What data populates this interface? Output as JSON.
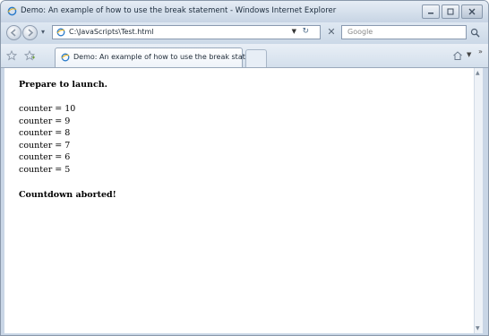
{
  "window": {
    "title": "Demo: An example of how to use the break statement - Windows Internet Explorer"
  },
  "nav": {
    "address": "C:\\JavaScripts\\Test.html",
    "search_placeholder": "Google"
  },
  "tabs": [
    {
      "label": "Demo: An example of how to use the break state..."
    }
  ],
  "page": {
    "intro": "Prepare to launch.",
    "counter_lines": [
      "counter = 10",
      "counter = 9",
      "counter = 8",
      "counter = 7",
      "counter = 6",
      "counter = 5"
    ],
    "outro": "Countdown aborted!"
  },
  "colors": {
    "chrome": "#c9d6e6",
    "page_bg": "#ffffff"
  }
}
